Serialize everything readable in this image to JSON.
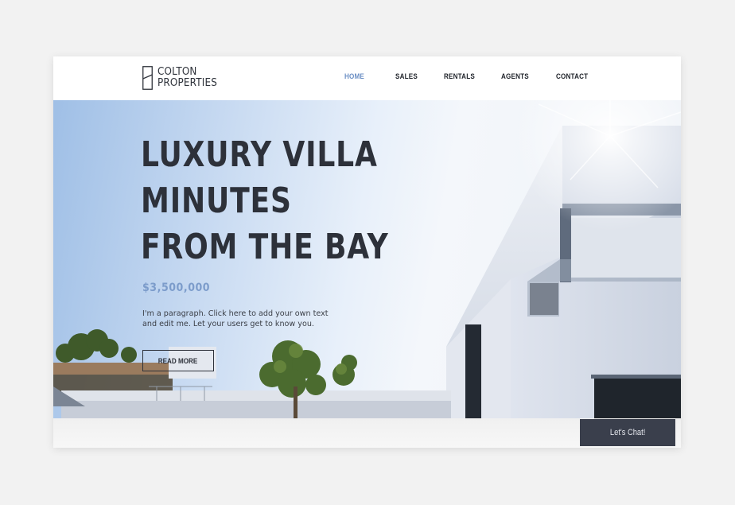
{
  "brand": {
    "line1": "COLTON",
    "line2": "PROPERTIES"
  },
  "nav": [
    {
      "label": "HOME",
      "active": true
    },
    {
      "label": "SALES",
      "active": false
    },
    {
      "label": "RENTALS",
      "active": false
    },
    {
      "label": "AGENTS",
      "active": false
    },
    {
      "label": "CONTACT",
      "active": false
    }
  ],
  "hero": {
    "headline": [
      "LUXURY VILLA",
      "MINUTES",
      "FROM THE BAY"
    ],
    "price": "$3,500,000",
    "paragraph": "I'm a paragraph. Click here to add your own text and edit me. Let your users get to know you.",
    "cta": "READ MORE"
  },
  "chat": {
    "label": "Let's Chat!"
  },
  "colors": {
    "accent": "#6b8fc4",
    "text": "#2d313a",
    "chat_bg": "#3a3f4c"
  }
}
